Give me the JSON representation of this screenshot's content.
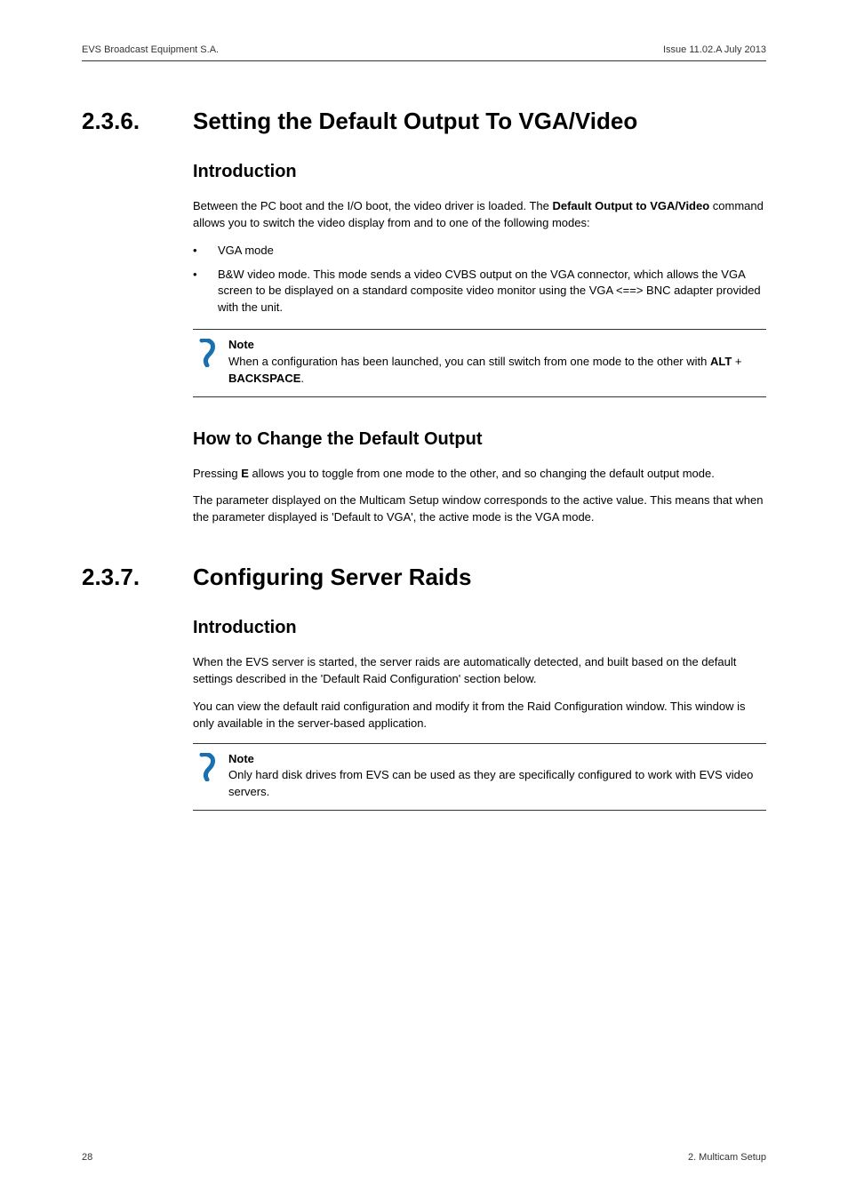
{
  "header": {
    "left": "EVS Broadcast Equipment S.A.",
    "right": "Issue 11.02.A  July 2013"
  },
  "s1": {
    "num": "2.3.6.",
    "title": "Setting the Default Output To VGA/Video",
    "intro_h": "Introduction",
    "intro_p1a": "Between the PC boot and the I/O boot, the video driver is loaded. The ",
    "intro_p1b": "Default Output to VGA/Video",
    "intro_p1c": " command allows you to switch the video display from and to one of the following modes:",
    "bul1": "VGA mode",
    "bul2": "B&W video mode. This mode sends a video CVBS output on the VGA connector, which allows the VGA screen to be displayed on a standard composite video monitor using the VGA <==> BNC adapter provided with the unit.",
    "note_t": "Note",
    "note_a": "When a configuration has been launched, you can still switch from one mode to the other with ",
    "note_alt": "ALT",
    "note_plus": " + ",
    "note_bs": "BACKSPACE",
    "note_dot": ".",
    "how_h": "How to Change the Default Output",
    "how_p1a": "Pressing ",
    "how_p1b": "E",
    "how_p1c": " allows you to toggle from one mode to the other, and so changing the default output mode.",
    "how_p2": "The parameter displayed on the Multicam Setup window corresponds to the active value. This means that when the parameter displayed is 'Default to VGA', the active mode is the VGA mode."
  },
  "s2": {
    "num": "2.3.7.",
    "title": "Configuring Server Raids",
    "intro_h": "Introduction",
    "p1": "When the EVS server is started, the server raids are automatically detected, and built based on the default settings described in the 'Default Raid Configuration' section below.",
    "p2": "You can view the default raid configuration and modify it from the Raid Configuration window. This window is only available in the server-based application.",
    "note_t": "Note",
    "note_b": "Only hard disk drives from EVS can be used as they are specifically configured to work with EVS video servers."
  },
  "footer": {
    "left": "28",
    "right": "2. Multicam Setup"
  }
}
